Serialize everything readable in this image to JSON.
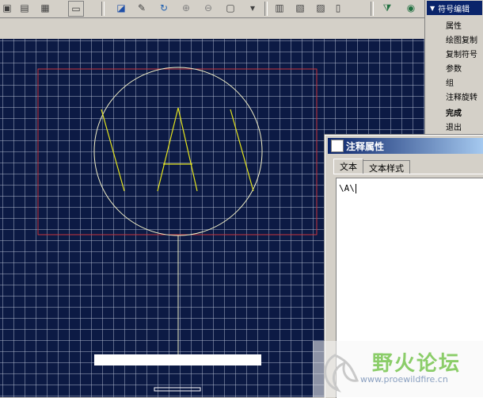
{
  "menu": {
    "header": "符号编辑",
    "items": [
      "属性",
      "绘图复制",
      "复制符号",
      "参数",
      "组",
      "注释旋转",
      "完成",
      "退出"
    ]
  },
  "dialog": {
    "title": "注释属性",
    "tabs": [
      "文本",
      "文本样式"
    ],
    "text_value": "\\A\\"
  },
  "canvas": {
    "symbol_text": "\\A\\"
  },
  "watermark": {
    "name": "野火论坛",
    "url": "www.proewildfire.cn"
  },
  "colors": {
    "canvas_bg": "#0c1a44",
    "frame": "#c8343c",
    "circle": "#f2f0c8",
    "symbol_glyph": "#e6e61e",
    "menu_header": "#0a246a"
  }
}
